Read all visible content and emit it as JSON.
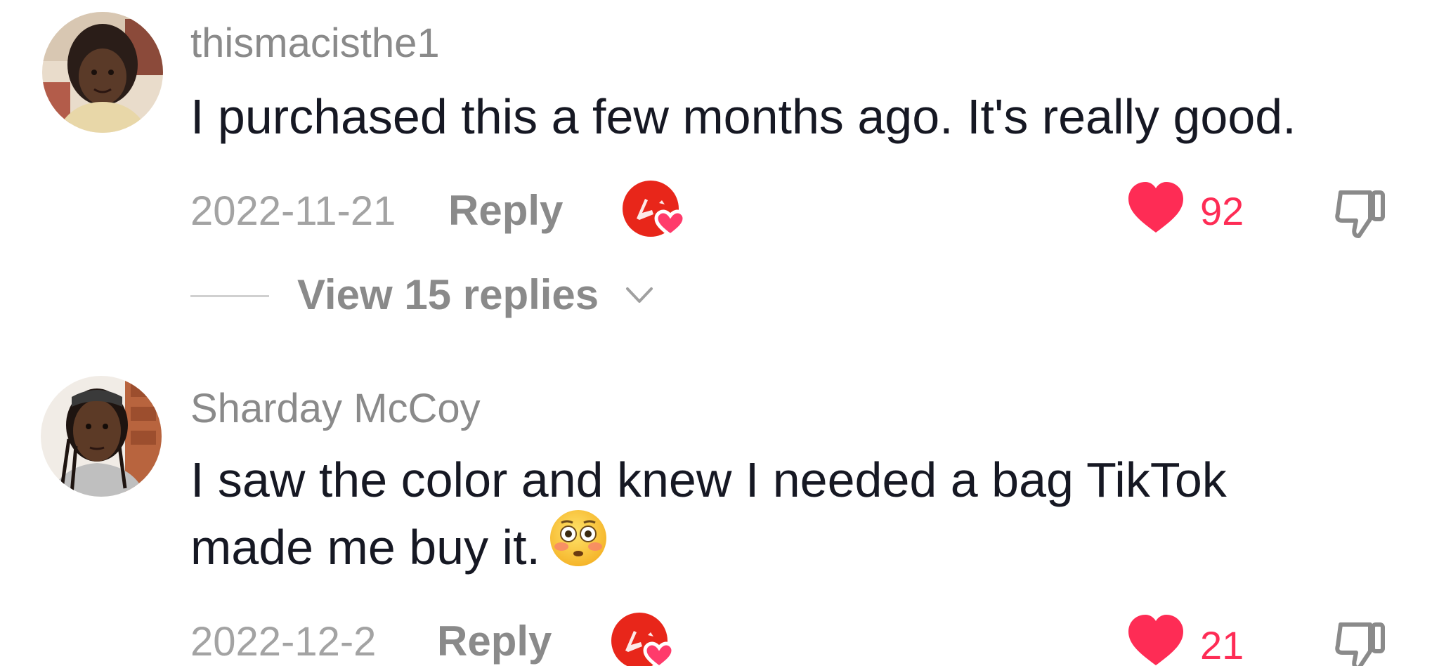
{
  "comments": [
    {
      "username": "thismacisthe1",
      "text": "I purchased this a few months ago. It's really good.",
      "date": "2022-11-21",
      "reply_label": "Reply",
      "likes": "92",
      "view_replies_label": "View 15 replies"
    },
    {
      "username": "Sharday McCoy",
      "text_line1": "I saw the color and knew I needed a bag TikTok",
      "text_line2": "made me buy it.",
      "emoji": "flushed-face-emoji",
      "date": "2022-12-2",
      "reply_label": "Reply",
      "likes": "21"
    }
  ],
  "colors": {
    "like_red": "#fe2c55",
    "creator_badge_red": "#e8261a",
    "muted_gray": "#8a8a8a",
    "text_dark": "#161823"
  },
  "icons": [
    "avatar",
    "creator-liked-badge-icon",
    "heart-icon",
    "dislike-icon",
    "chevron-down-icon",
    "flushed-face-emoji"
  ]
}
